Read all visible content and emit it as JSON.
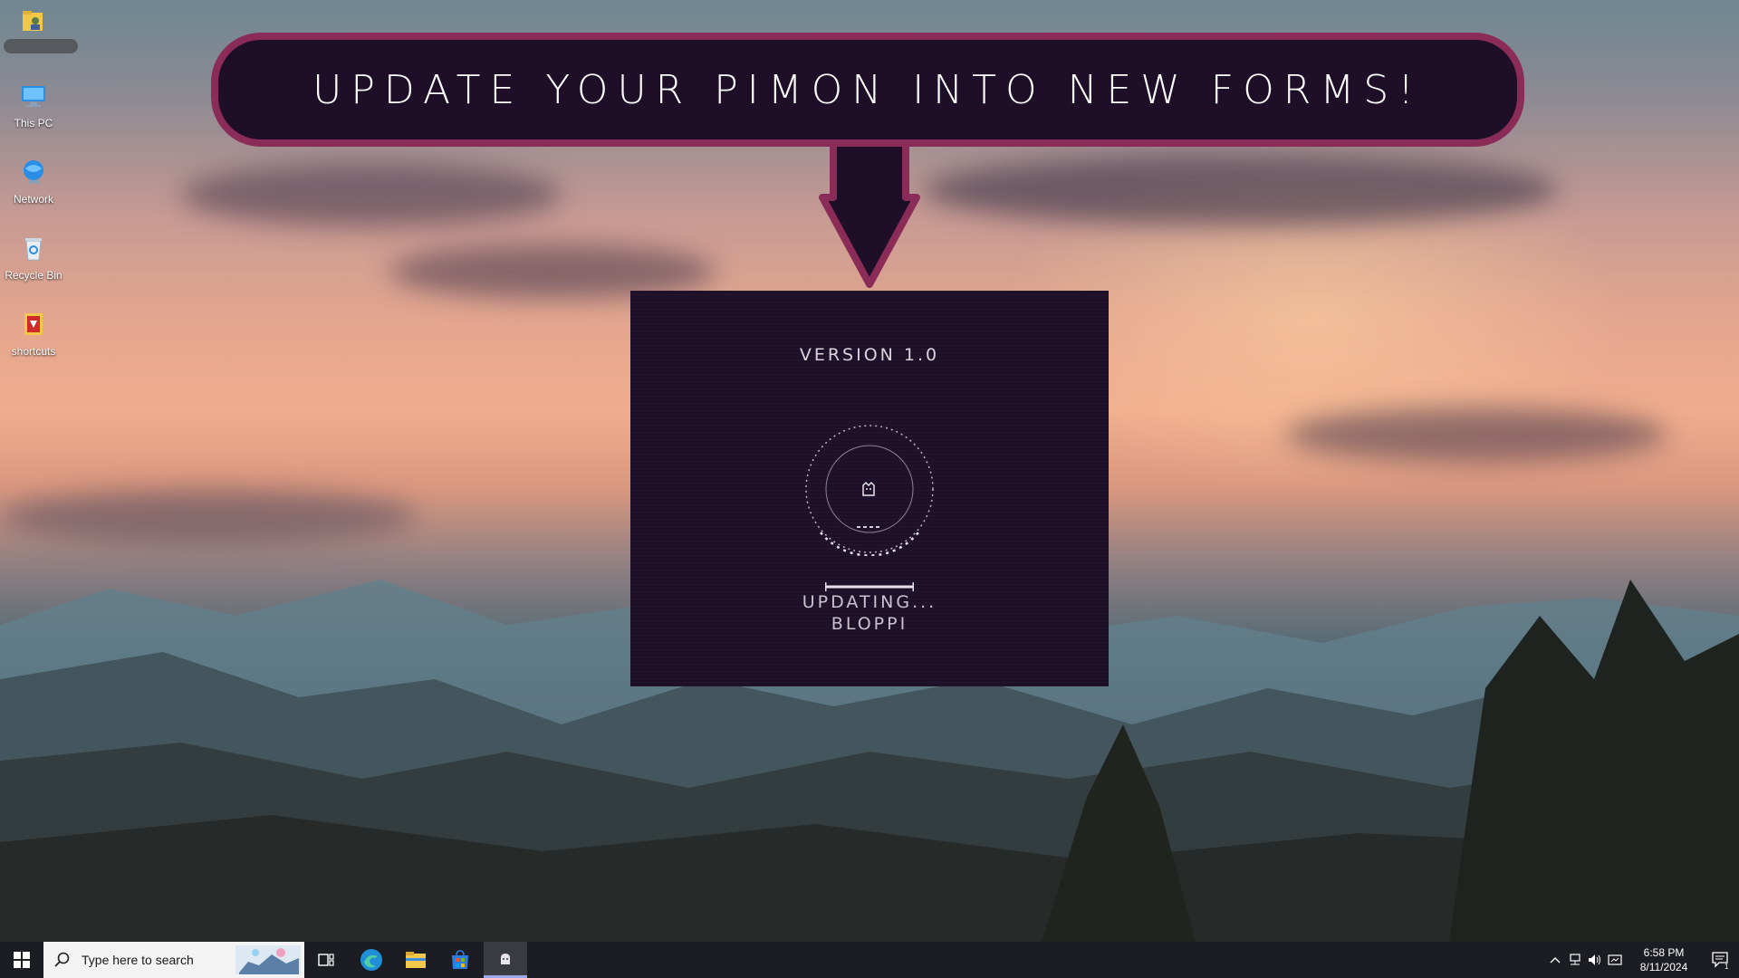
{
  "desktop": {
    "icons": [
      {
        "label": "",
        "icon": "user-folder-icon"
      },
      {
        "label": "This PC",
        "icon": "this-pc-icon"
      },
      {
        "label": "Network",
        "icon": "network-icon"
      },
      {
        "label": "Recycle Bin",
        "icon": "recycle-bin-icon"
      },
      {
        "label": "shortcuts",
        "icon": "shortcuts-icon"
      }
    ]
  },
  "banner": {
    "text": "UPDATE YOUR PIMON INTO NEW FORMS!"
  },
  "updater": {
    "version": "VERSION 1.0",
    "status": "UPDATING...",
    "name": "BLOPPI",
    "progress": 1.0
  },
  "taskbar": {
    "search_placeholder": "Type here to search",
    "apps": [
      "task-view-icon",
      "edge-icon",
      "file-explorer-icon",
      "store-icon",
      "pimon-app-icon"
    ],
    "clock": {
      "time": "6:58 PM",
      "date": "8/11/2024"
    },
    "notification_count": "1"
  },
  "colors": {
    "banner_bg": "#1e0e28",
    "banner_border": "#8a2c57",
    "window_bg": "#1d1028"
  }
}
